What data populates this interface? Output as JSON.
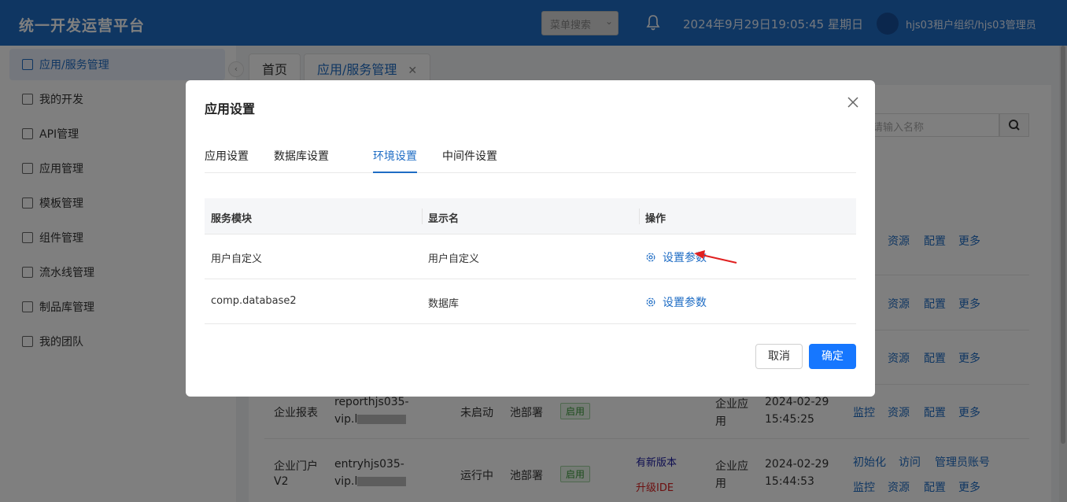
{
  "header": {
    "title": "统一开发运营平台",
    "menu_search": "菜单搜索",
    "datetime": "2024年9月29日19:05:45 星期日",
    "user": "hjs03租户组织/hjs03管理员"
  },
  "sidebar": {
    "items": [
      {
        "label": "应用/服务管理",
        "icon": "app-service-icon"
      },
      {
        "label": "我的开发",
        "icon": "dev-icon"
      },
      {
        "label": "API管理",
        "icon": "api-icon"
      },
      {
        "label": "应用管理",
        "icon": "grid-icon"
      },
      {
        "label": "模板管理",
        "icon": "template-icon"
      },
      {
        "label": "组件管理",
        "icon": "component-icon"
      },
      {
        "label": "流水线管理",
        "icon": "pipeline-icon"
      },
      {
        "label": "制品库管理",
        "icon": "folder-icon"
      },
      {
        "label": "我的团队",
        "icon": "team-icon"
      }
    ]
  },
  "page_tabs": {
    "home": "首页",
    "current": "应用/服务管理"
  },
  "background": {
    "search_placeholder": "请输入名称",
    "row_links": {
      "resource": "资源",
      "config": "配置",
      "more": "更多",
      "monitor": "监控",
      "init": "初始化",
      "visit": "访问",
      "admin_account": "管理员账号"
    },
    "row1": {
      "name": "企业报表",
      "code_a": "reporthjs035-",
      "code_b": "vip.l",
      "status": "未启动",
      "dept": "池部署",
      "badge": "启用",
      "type_a": "企业应",
      "type_b": "用",
      "date": "2024-02-29",
      "time": "15:45:25"
    },
    "row2": {
      "name_a": "企业门户",
      "name_b": "V2",
      "code_a": "entryhjs035-",
      "code_b": "vip.l",
      "status": "运行中",
      "dept": "池部署",
      "badge": "启用",
      "new_version": "有新版本",
      "upgrade": "升级IDE",
      "type_a": "企业应",
      "type_b": "用",
      "date": "2024-02-29",
      "time": "15:44:53"
    }
  },
  "modal": {
    "title": "应用设置",
    "tabs": [
      "应用设置",
      "数据库设置",
      "环境设置",
      "中间件设置"
    ],
    "active_tab": "环境设置",
    "columns": [
      "服务模块",
      "显示名",
      "操作"
    ],
    "rows": [
      {
        "module": "用户自定义",
        "display": "用户自定义",
        "action": "设置参数"
      },
      {
        "module": "comp.database2",
        "display": "数据库",
        "action": "设置参数"
      }
    ],
    "cancel": "取消",
    "ok": "确定"
  },
  "colors": {
    "brand": "#1e6cc4",
    "primary_button": "#1677ff",
    "annotation_arrow": "#e02020"
  }
}
